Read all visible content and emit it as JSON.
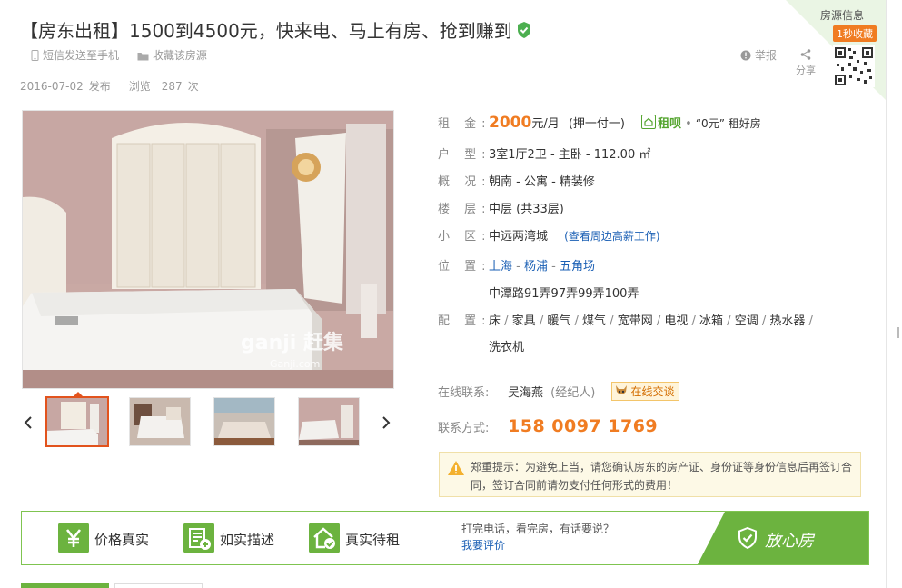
{
  "listing": {
    "title": "【房东出租】1500到4500元，快来电、马上有房、抢到赚到",
    "sms_label": "短信发送至手机",
    "favorite_label": "收藏该房源",
    "publish_date": "2016-07-02",
    "publish_suffix": "发布",
    "views_label": "浏览",
    "views_count": "287",
    "views_unit": "次",
    "report_label": "举报",
    "share_label": "分享"
  },
  "corner": {
    "label": "房源信息",
    "badge": "1秒收藏"
  },
  "gallery": {
    "watermark": "ganji 赶集",
    "watermark_url": "Ganji.com",
    "thumbs": [
      "bedroom-1",
      "bedroom-2",
      "bedroom-3",
      "bedroom-4"
    ],
    "active_index": 0
  },
  "details": {
    "rent_label": "租 金:",
    "rent_value": "2000",
    "rent_unit": "元/月",
    "rent_terms": "(押一付一)",
    "zubai_label": "租呗",
    "zubai_dot": "•",
    "zubai_text": "“0元” 租好房",
    "layout_label": "户 型:",
    "layout_value": "3室1厅2卫 - 主卧 - 112.00 ㎡",
    "overview_label": "概 况:",
    "overview_value": "朝南 - 公寓 - 精装修",
    "floor_label": "楼 层:",
    "floor_value": "中层 (共33层)",
    "community_label": "小 区:",
    "community_value": "中远两湾城",
    "community_link": "(查看周边高薪工作)",
    "location_label": "位 置:",
    "location_links": [
      "上海",
      "杨浦",
      "五角场"
    ],
    "address": "中潭路91弄97弄99弄100弄",
    "amenities_label": "配 置:",
    "amenities": [
      "床",
      "家具",
      "暖气",
      "煤气",
      "宽带网",
      "电视",
      "冰箱",
      "空调",
      "热水器",
      "洗衣机"
    ],
    "contact_label": "在线联系:",
    "contact_name": "吴海燕",
    "contact_role": "(经纪人)",
    "chat_label": "在线交谈",
    "phone_label": "联系方式:",
    "phone_value": "158 0097 1769"
  },
  "warning": {
    "text": "郑重提示：为避免上当，请您确认房东的房产证、身份证等身份信息后再签订合同，签订合同前请勿支付任何形式的费用！"
  },
  "guarantee": {
    "items": [
      "价格真实",
      "如实描述",
      "真实待租"
    ],
    "tip": "打完电话，看完房，有话要说？",
    "review_link": "我要评价",
    "badge": "放心房"
  },
  "colors": {
    "accent_orange": "#f07c22",
    "brand_green": "#6cb33f",
    "link_blue": "#1a5fb4"
  }
}
